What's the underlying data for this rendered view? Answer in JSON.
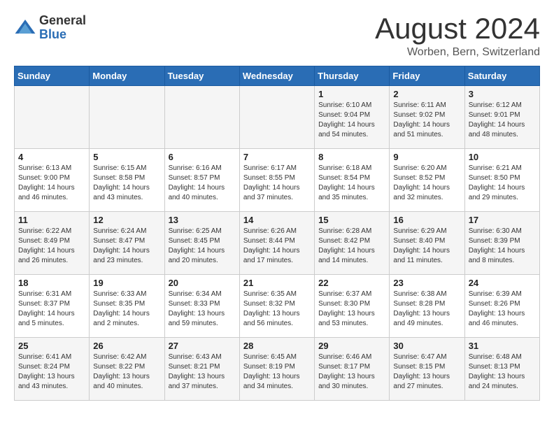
{
  "header": {
    "logo_general": "General",
    "logo_blue": "Blue",
    "month_title": "August 2024",
    "location": "Worben, Bern, Switzerland"
  },
  "calendar": {
    "days_of_week": [
      "Sunday",
      "Monday",
      "Tuesday",
      "Wednesday",
      "Thursday",
      "Friday",
      "Saturday"
    ],
    "weeks": [
      [
        {
          "day": "",
          "info": ""
        },
        {
          "day": "",
          "info": ""
        },
        {
          "day": "",
          "info": ""
        },
        {
          "day": "",
          "info": ""
        },
        {
          "day": "1",
          "info": "Sunrise: 6:10 AM\nSunset: 9:04 PM\nDaylight: 14 hours\nand 54 minutes."
        },
        {
          "day": "2",
          "info": "Sunrise: 6:11 AM\nSunset: 9:02 PM\nDaylight: 14 hours\nand 51 minutes."
        },
        {
          "day": "3",
          "info": "Sunrise: 6:12 AM\nSunset: 9:01 PM\nDaylight: 14 hours\nand 48 minutes."
        }
      ],
      [
        {
          "day": "4",
          "info": "Sunrise: 6:13 AM\nSunset: 9:00 PM\nDaylight: 14 hours\nand 46 minutes."
        },
        {
          "day": "5",
          "info": "Sunrise: 6:15 AM\nSunset: 8:58 PM\nDaylight: 14 hours\nand 43 minutes."
        },
        {
          "day": "6",
          "info": "Sunrise: 6:16 AM\nSunset: 8:57 PM\nDaylight: 14 hours\nand 40 minutes."
        },
        {
          "day": "7",
          "info": "Sunrise: 6:17 AM\nSunset: 8:55 PM\nDaylight: 14 hours\nand 37 minutes."
        },
        {
          "day": "8",
          "info": "Sunrise: 6:18 AM\nSunset: 8:54 PM\nDaylight: 14 hours\nand 35 minutes."
        },
        {
          "day": "9",
          "info": "Sunrise: 6:20 AM\nSunset: 8:52 PM\nDaylight: 14 hours\nand 32 minutes."
        },
        {
          "day": "10",
          "info": "Sunrise: 6:21 AM\nSunset: 8:50 PM\nDaylight: 14 hours\nand 29 minutes."
        }
      ],
      [
        {
          "day": "11",
          "info": "Sunrise: 6:22 AM\nSunset: 8:49 PM\nDaylight: 14 hours\nand 26 minutes."
        },
        {
          "day": "12",
          "info": "Sunrise: 6:24 AM\nSunset: 8:47 PM\nDaylight: 14 hours\nand 23 minutes."
        },
        {
          "day": "13",
          "info": "Sunrise: 6:25 AM\nSunset: 8:45 PM\nDaylight: 14 hours\nand 20 minutes."
        },
        {
          "day": "14",
          "info": "Sunrise: 6:26 AM\nSunset: 8:44 PM\nDaylight: 14 hours\nand 17 minutes."
        },
        {
          "day": "15",
          "info": "Sunrise: 6:28 AM\nSunset: 8:42 PM\nDaylight: 14 hours\nand 14 minutes."
        },
        {
          "day": "16",
          "info": "Sunrise: 6:29 AM\nSunset: 8:40 PM\nDaylight: 14 hours\nand 11 minutes."
        },
        {
          "day": "17",
          "info": "Sunrise: 6:30 AM\nSunset: 8:39 PM\nDaylight: 14 hours\nand 8 minutes."
        }
      ],
      [
        {
          "day": "18",
          "info": "Sunrise: 6:31 AM\nSunset: 8:37 PM\nDaylight: 14 hours\nand 5 minutes."
        },
        {
          "day": "19",
          "info": "Sunrise: 6:33 AM\nSunset: 8:35 PM\nDaylight: 14 hours\nand 2 minutes."
        },
        {
          "day": "20",
          "info": "Sunrise: 6:34 AM\nSunset: 8:33 PM\nDaylight: 13 hours\nand 59 minutes."
        },
        {
          "day": "21",
          "info": "Sunrise: 6:35 AM\nSunset: 8:32 PM\nDaylight: 13 hours\nand 56 minutes."
        },
        {
          "day": "22",
          "info": "Sunrise: 6:37 AM\nSunset: 8:30 PM\nDaylight: 13 hours\nand 53 minutes."
        },
        {
          "day": "23",
          "info": "Sunrise: 6:38 AM\nSunset: 8:28 PM\nDaylight: 13 hours\nand 49 minutes."
        },
        {
          "day": "24",
          "info": "Sunrise: 6:39 AM\nSunset: 8:26 PM\nDaylight: 13 hours\nand 46 minutes."
        }
      ],
      [
        {
          "day": "25",
          "info": "Sunrise: 6:41 AM\nSunset: 8:24 PM\nDaylight: 13 hours\nand 43 minutes."
        },
        {
          "day": "26",
          "info": "Sunrise: 6:42 AM\nSunset: 8:22 PM\nDaylight: 13 hours\nand 40 minutes."
        },
        {
          "day": "27",
          "info": "Sunrise: 6:43 AM\nSunset: 8:21 PM\nDaylight: 13 hours\nand 37 minutes."
        },
        {
          "day": "28",
          "info": "Sunrise: 6:45 AM\nSunset: 8:19 PM\nDaylight: 13 hours\nand 34 minutes."
        },
        {
          "day": "29",
          "info": "Sunrise: 6:46 AM\nSunset: 8:17 PM\nDaylight: 13 hours\nand 30 minutes."
        },
        {
          "day": "30",
          "info": "Sunrise: 6:47 AM\nSunset: 8:15 PM\nDaylight: 13 hours\nand 27 minutes."
        },
        {
          "day": "31",
          "info": "Sunrise: 6:48 AM\nSunset: 8:13 PM\nDaylight: 13 hours\nand 24 minutes."
        }
      ]
    ]
  }
}
